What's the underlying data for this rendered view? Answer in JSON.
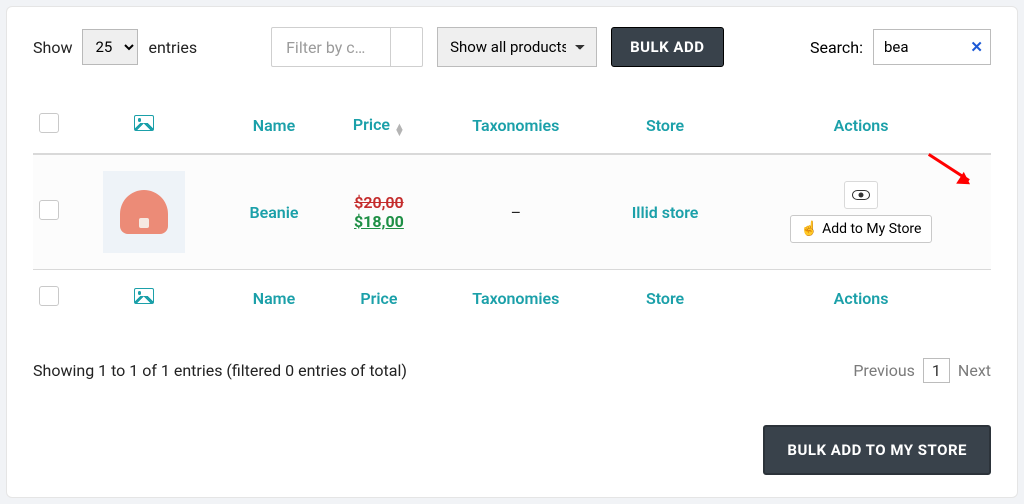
{
  "toolbar": {
    "show_label": "Show",
    "entries_label": "entries",
    "per_page": "25",
    "filter_category": "Filter by c…",
    "product_filter": "Show all products",
    "bulk_add": "BULK ADD",
    "search_label": "Search:",
    "search_value": "bea"
  },
  "columns": {
    "name": "Name",
    "price": "Price",
    "taxonomies": "Taxonomies",
    "store": "Store",
    "actions": "Actions"
  },
  "rows": [
    {
      "name": "Beanie",
      "price_old": "$20,00",
      "price_new": "$18,00",
      "taxonomies": "–",
      "store": "Illid store",
      "action_add": "Add to My Store"
    }
  ],
  "footer": {
    "info": "Showing 1 to 1 of 1 entries (filtered 0 entries of total)",
    "previous": "Previous",
    "current_page": "1",
    "next": "Next",
    "bulk_add_store": "BULK ADD TO MY STORE"
  }
}
